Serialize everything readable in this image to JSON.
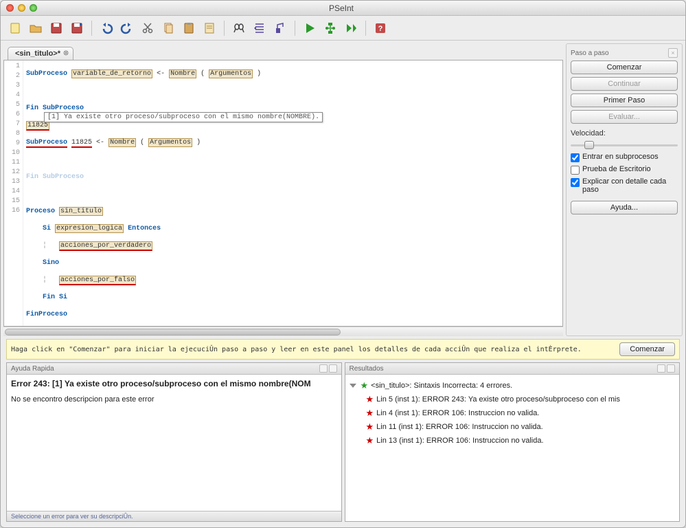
{
  "window": {
    "title": "PSeInt"
  },
  "tab": {
    "label": "<sin_titulo>*"
  },
  "gutter": [
    "1",
    "2",
    "3",
    "4",
    "5",
    "6",
    "7",
    "8",
    "9",
    "10",
    "11",
    "12",
    "13",
    "14",
    "15",
    "16"
  ],
  "code": {
    "l1_kw": "SubProceso",
    "l1_v1": "variable_de_retorno",
    "l1_arrow": " <- ",
    "l1_v2": "Nombre",
    "l1_p1": " ( ",
    "l1_v3": "Argumentos",
    "l1_p2": " )",
    "l3": "Fin SubProceso",
    "l4": "11825",
    "l5_kw": "SubProceso",
    "l5_v1": "11825",
    "l5_arrow": " <- ",
    "l5_v2": "Nombre",
    "l5_p1": " ( ",
    "l5_v3": "Argumentos",
    "l5_p2": " )",
    "tooltip": "[1] Ya existe otro proceso/subproceso con el mismo nombre(NOMBRE).",
    "l7": "Fin SubProceso",
    "l9_kw": "Proceso",
    "l9_v": "sin_titulo",
    "l10_si": "Si",
    "l10_exp": "expresion_logica",
    "l10_ent": "Entonces",
    "l11": "acciones_por_verdadero",
    "l12": "Sino",
    "l13": "acciones_por_falso",
    "l14": "Fin Si",
    "l15": "FinProceso"
  },
  "side": {
    "title": "Paso a paso",
    "comenzar": "Comenzar",
    "continuar": "Continuar",
    "primer": "Primer Paso",
    "evaluar": "Evaluar...",
    "velocidad": "Velocidad:",
    "chk1": "Entrar en subprocesos",
    "chk2": "Prueba de Escritorio",
    "chk3": "Explicar con detalle cada paso",
    "ayuda": "Ayuda..."
  },
  "hint": {
    "text": "Haga click en \"Comenzar\" para iniciar la ejecuciÛn paso a paso y leer en este panel los detalles de cada acciÛn que realiza el intÈrprete.",
    "btn": "Comenzar"
  },
  "help_panel": {
    "title": "Ayuda Rapida",
    "err_title": "Error 243: [1] Ya existe otro proceso/subproceso con el mismo nombre(NOM",
    "err_body": "No se encontro descripcion para este error"
  },
  "results_panel": {
    "title": "Resultados",
    "root": "<sin_titulo>: Sintaxis Incorrecta: 4 errores.",
    "items": [
      "Lin 5 (inst 1): ERROR 243: Ya existe otro proceso/subproceso con el mis",
      "Lin 4 (inst 1): ERROR 106: Instruccion no valida.",
      "Lin 11 (inst 1): ERROR 106: Instruccion no valida.",
      "Lin 13 (inst 1): ERROR 106: Instruccion no valida."
    ]
  },
  "footer": "Seleccione un error para ver su descripciÛn.",
  "icons": {
    "new": "#f2c94c",
    "open": "#e2a23a",
    "save": "#b43a3a",
    "saveas": "#b43a3a",
    "undo": "#2a5aa7",
    "redo": "#2a5aa7",
    "cut": "#777",
    "copy": "#c87a3a",
    "paste": "#c87a3a",
    "notes": "#c87a3a",
    "find": "#444",
    "wand": "#5a4aa0",
    "brush": "#5a4aa0",
    "play": "#2a9a2a",
    "flow": "#2a9a2a",
    "step": "#2a9a2a",
    "help": "#b43a3a"
  }
}
